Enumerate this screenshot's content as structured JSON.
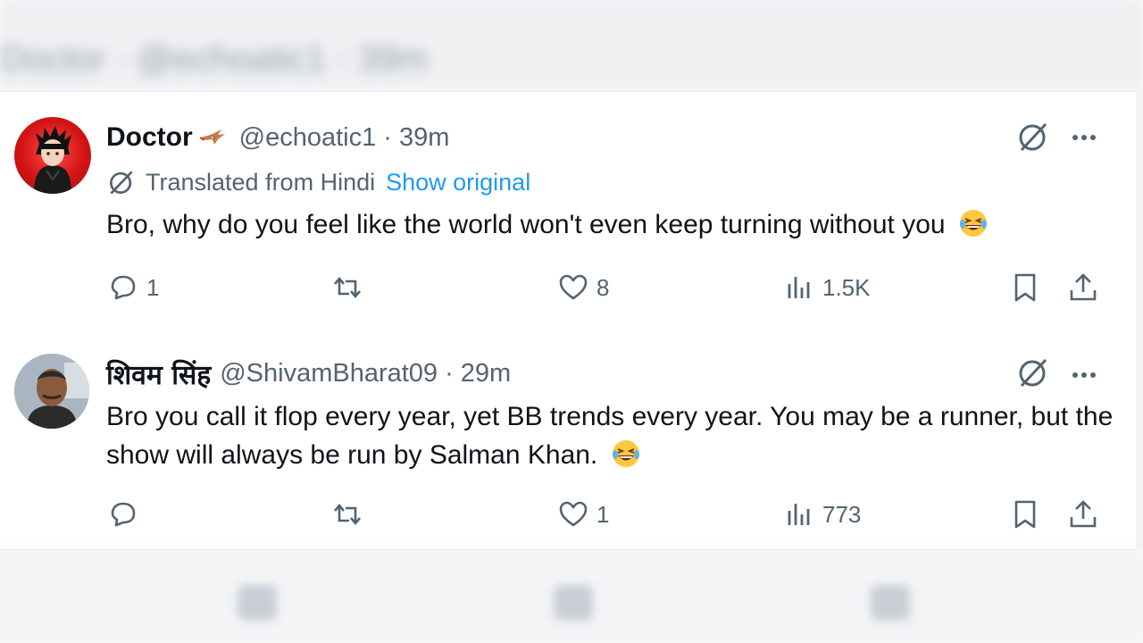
{
  "background_header": {
    "text": "Doctor · @echoatic1 · 39m"
  },
  "tweets": [
    {
      "author_name": "Doctor",
      "handle": "@echoatic1",
      "separator": "·",
      "time": "39m",
      "translated_label": "Translated from Hindi",
      "show_original": "Show original",
      "text": "Bro, why do you feel like the world won't even keep turning without you",
      "replies": "1",
      "retweets": "",
      "likes": "8",
      "views": "1.5K"
    },
    {
      "author_name": "शिवम सिंह",
      "handle": "@ShivamBharat09",
      "separator": "·",
      "time": "29m",
      "text": "Bro you call it flop every year, yet BB trends every year. You may be a runner, but the show will always be run by Salman Khan.",
      "replies": "",
      "retweets": "",
      "likes": "1",
      "views": "773"
    }
  ],
  "icons": {
    "reply": "reply-icon",
    "retweet": "retweet-icon",
    "like": "heart-icon",
    "views": "views-icon",
    "bookmark": "bookmark-icon",
    "share": "share-icon",
    "grok": "grok-icon",
    "more": "more-icon"
  },
  "colors": {
    "text": "#0f1419",
    "secondary": "#536471",
    "link": "#1d9bf0"
  }
}
